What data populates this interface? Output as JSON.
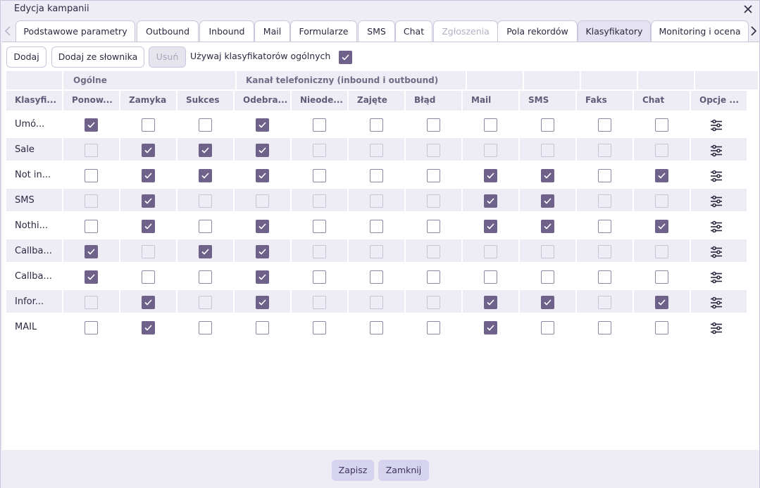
{
  "window": {
    "title": "Edycja kampanii",
    "close_icon": "close-icon"
  },
  "tabs": [
    {
      "label": "Podstawowe parametry",
      "state": "normal"
    },
    {
      "label": "Outbound",
      "state": "normal"
    },
    {
      "label": "Inbound",
      "state": "normal"
    },
    {
      "label": "Mail",
      "state": "normal"
    },
    {
      "label": "Formularze",
      "state": "normal"
    },
    {
      "label": "SMS",
      "state": "normal"
    },
    {
      "label": "Chat",
      "state": "normal"
    },
    {
      "label": "Zgłoszenia",
      "state": "disabled"
    },
    {
      "label": "Pola rekordów",
      "state": "normal"
    },
    {
      "label": "Klasyfikatory",
      "state": "active"
    },
    {
      "label": "Monitoring i ocena",
      "state": "normal"
    }
  ],
  "toolbar": {
    "add_label": "Dodaj",
    "add_from_dict_label": "Dodaj ze słownika",
    "remove_label": "Usuń",
    "use_general_label": "Używaj klasyfikatorów ogólnych",
    "use_general_checked": true
  },
  "table": {
    "groups": {
      "general": "Ogólne",
      "phone": "Kanał telefoniczny (inbound i outbound)"
    },
    "columns": [
      "Klasyfi...",
      "Ponow...",
      "Zamyka",
      "Sukces",
      "Odebra...",
      "Nieode...",
      "Zajęte",
      "Błąd",
      "Mail",
      "SMS",
      "Faks",
      "Chat",
      "Opcje ..."
    ],
    "rows": [
      {
        "name": "Umó...",
        "disabled": false,
        "values": [
          1,
          0,
          0,
          1,
          0,
          0,
          0,
          0,
          0,
          0,
          0
        ]
      },
      {
        "name": "Sale",
        "disabled": true,
        "values": [
          0,
          1,
          1,
          1,
          0,
          0,
          0,
          0,
          0,
          0,
          0
        ]
      },
      {
        "name": "Not in...",
        "disabled": false,
        "values": [
          0,
          1,
          1,
          1,
          0,
          0,
          0,
          1,
          1,
          0,
          1
        ]
      },
      {
        "name": "SMS",
        "disabled": true,
        "values": [
          0,
          1,
          0,
          0,
          0,
          0,
          0,
          1,
          1,
          0,
          0
        ]
      },
      {
        "name": "Nothi...",
        "disabled": false,
        "values": [
          0,
          1,
          0,
          1,
          0,
          0,
          0,
          1,
          1,
          0,
          1
        ]
      },
      {
        "name": "Callba...",
        "disabled": true,
        "values": [
          1,
          0,
          1,
          1,
          0,
          0,
          0,
          0,
          0,
          0,
          0
        ]
      },
      {
        "name": "Callba...",
        "disabled": false,
        "values": [
          1,
          0,
          0,
          1,
          0,
          0,
          0,
          0,
          0,
          0,
          0
        ]
      },
      {
        "name": "Infor...",
        "disabled": true,
        "values": [
          0,
          1,
          0,
          1,
          0,
          0,
          0,
          1,
          1,
          0,
          1
        ]
      },
      {
        "name": "MAIL",
        "disabled": false,
        "values": [
          0,
          1,
          0,
          0,
          0,
          0,
          0,
          1,
          0,
          0,
          0
        ]
      }
    ],
    "options_icon": "sliders-icon"
  },
  "footer": {
    "save_label": "Zapisz",
    "close_label": "Zamknij"
  },
  "colors": {
    "accent": "#6e618a",
    "header_bg": "#eeedf6",
    "button_primary_bg": "#d6d3ee"
  }
}
